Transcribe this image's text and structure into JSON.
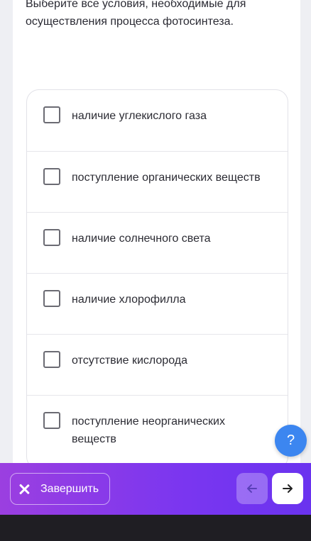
{
  "question": {
    "text": "Выберите все условия, необходимые для осуществления процесса фотосинтеза."
  },
  "options": [
    {
      "label": "наличие углекислого газа",
      "checked": false
    },
    {
      "label": "поступление органических веществ",
      "checked": false
    },
    {
      "label": "наличие солнечного света",
      "checked": false
    },
    {
      "label": "наличие хлорофилла",
      "checked": false
    },
    {
      "label": "отсутствие кислорода",
      "checked": false
    },
    {
      "label": "поступление неорганических веществ",
      "checked": false
    }
  ],
  "help": {
    "label": "?"
  },
  "bottom_bar": {
    "finish_label": "Завершить",
    "back_icon": "arrow-left-icon",
    "next_icon": "arrow-right-icon"
  },
  "colors": {
    "accent_purple": "#7a36f0",
    "help_blue": "#3c86f0",
    "footer_dark": "#1f1e23"
  }
}
